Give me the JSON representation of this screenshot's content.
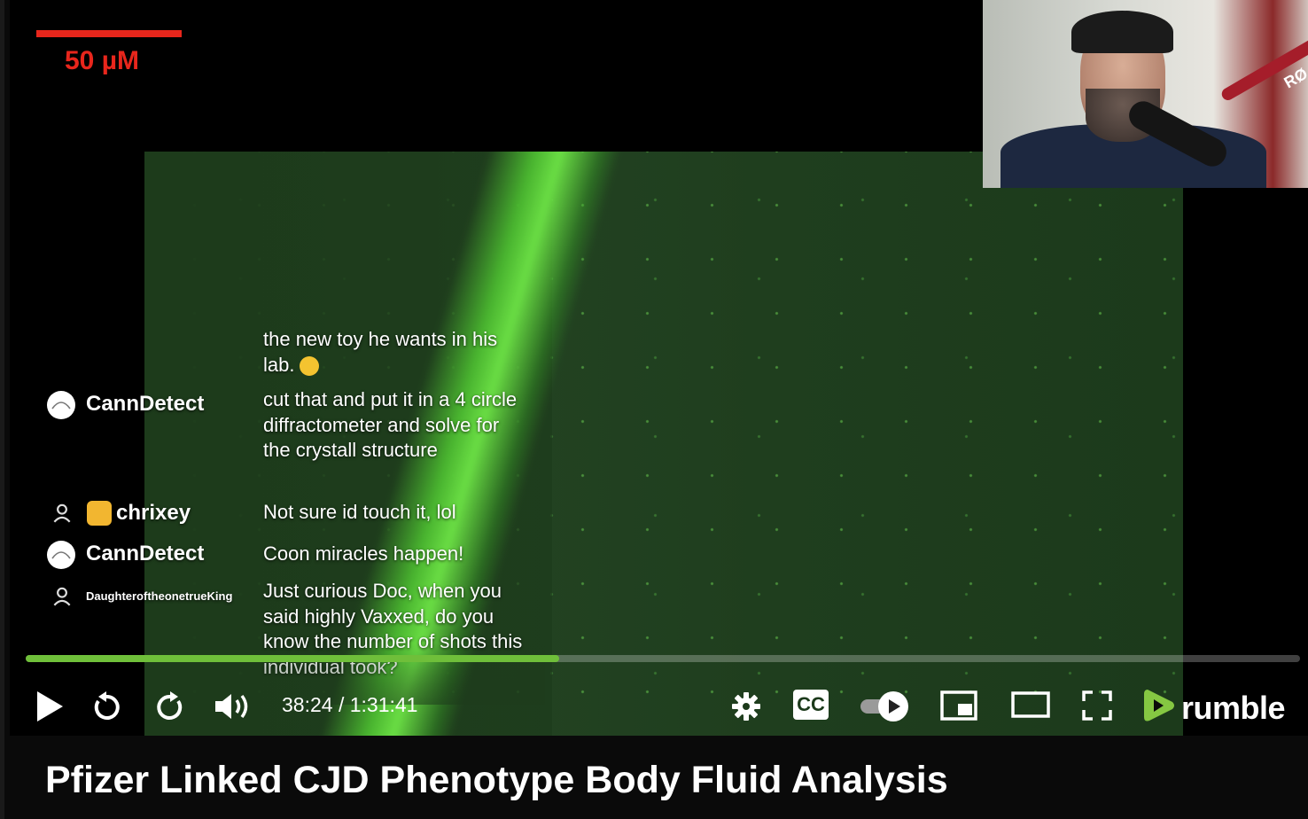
{
  "overlay": {
    "scale_label": "50 µM"
  },
  "webcam": {
    "mic_brand": "RØ"
  },
  "chat": {
    "messages": [
      {
        "user": "",
        "text": "the new toy he wants in his lab.",
        "emoji": "smiling-face"
      },
      {
        "user": "CannDetect",
        "avatar_text": "",
        "text": "cut that and put it in a 4 circle diffractometer and solve for the crystall structure"
      },
      {
        "user": "chrixey",
        "text": "Not sure id touch it, lol"
      },
      {
        "user": "CannDetect",
        "avatar_text": "",
        "text": "Coon miracles happen!"
      },
      {
        "user": "DaughteroftheonetrueKing",
        "text": "Just curious Doc, when you said highly Vaxxed, do you know the number of shots this individual took?"
      }
    ]
  },
  "player": {
    "current_time": "38:24",
    "duration": "1:31:41",
    "time_display": "38:24 / 1:31:41",
    "progress_fraction": 0.4187,
    "accent_color": "#6fbf3a",
    "brand": "rumble",
    "icons": [
      "play-icon",
      "rewind-icon",
      "forward-icon",
      "volume-icon",
      "settings-icon",
      "captions-icon",
      "autoplay-toggle-icon",
      "pip-icon",
      "theater-icon",
      "fullscreen-icon"
    ],
    "cc_label": "CC"
  },
  "video": {
    "title": "Pfizer Linked CJD Phenotype Body Fluid Analysis"
  }
}
